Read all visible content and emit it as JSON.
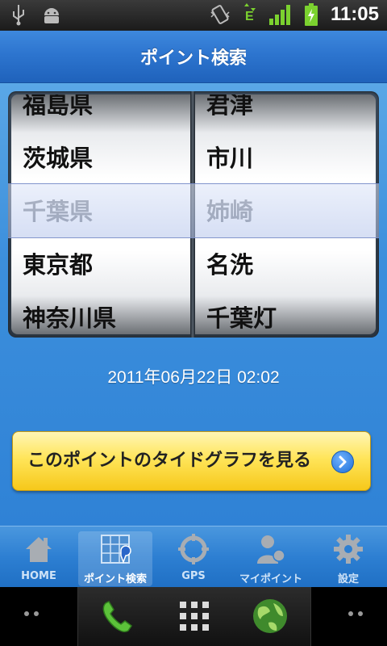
{
  "status_bar": {
    "time": "11:05",
    "icons": [
      "usb-icon",
      "android-debug-icon",
      "vibrate-icon",
      "edge-data-icon",
      "signal-icon",
      "battery-charging-icon"
    ],
    "edge_label": "E"
  },
  "header": {
    "title": "ポイント検索"
  },
  "picker": {
    "prefectures": [
      "福島県",
      "茨城県",
      "千葉県",
      "東京都",
      "神奈川県"
    ],
    "points": [
      "君津",
      "市川",
      "姉崎",
      "名洗",
      "千葉灯"
    ],
    "selected_index": 2
  },
  "datetime": "2011年06月22日 02:02",
  "tide_button": {
    "label": "このポイントのタイドグラフを見る"
  },
  "tabs": [
    {
      "id": "home",
      "label": "HOME",
      "icon": "home-icon"
    },
    {
      "id": "search",
      "label": "ポイント検索",
      "icon": "map-search-icon",
      "active": true
    },
    {
      "id": "gps",
      "label": "GPS",
      "icon": "gps-icon"
    },
    {
      "id": "my",
      "label": "マイポイント",
      "icon": "my-point-icon"
    },
    {
      "id": "settings",
      "label": "設定",
      "icon": "gear-icon"
    }
  ],
  "nav": {
    "icons": [
      "phone-icon",
      "app-grid-icon",
      "browser-globe-icon"
    ]
  },
  "colors": {
    "accent_blue": "#2f82d6",
    "button_yellow": "#ffe55a",
    "title_blue": "#2d75cf"
  }
}
